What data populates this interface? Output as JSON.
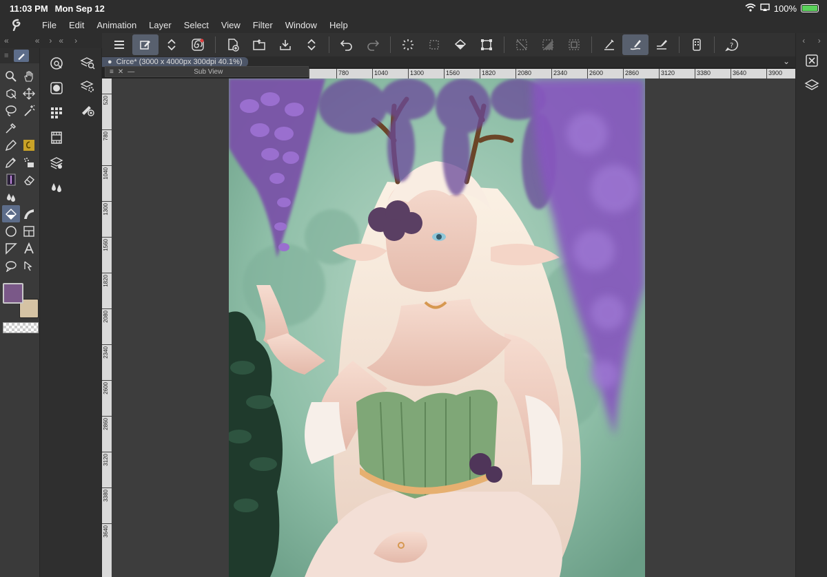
{
  "status": {
    "time": "11:03 PM",
    "date": "Mon Sep 12",
    "battery": "100%"
  },
  "menu": [
    "File",
    "Edit",
    "Animation",
    "Layer",
    "Select",
    "View",
    "Filter",
    "Window",
    "Help"
  ],
  "document": {
    "tab": "Circe* (3000 x 4000px 300dpi 40.1%)",
    "subview_title": "Sub View"
  },
  "ruler": {
    "h": [
      "780",
      "1040",
      "1300",
      "1560",
      "1820",
      "2080",
      "2340",
      "2600",
      "2860",
      "3120",
      "3380",
      "3640",
      "3900"
    ],
    "v": [
      "520",
      "780",
      "1040",
      "1300",
      "1560",
      "1820",
      "2080",
      "2340",
      "2600",
      "2860",
      "3120",
      "3380",
      "3640"
    ]
  },
  "colors": {
    "main": "#7a5888",
    "sub": "#d5c3a4",
    "accent": "#58606e",
    "tool_selected": "#5d6d8a"
  },
  "toolbar_icons": [
    "menu-icon",
    "transform-tool-icon",
    "up-down-arrows-icon",
    "spiral-icon",
    "new-canvas-icon",
    "open-folder-icon",
    "save-icon",
    "up-down-arrows-icon",
    "undo-icon",
    "redo-icon",
    "loading-icon",
    "clear-selection-icon",
    "fill-icon",
    "crop-icon",
    "deselect-icon",
    "invert-selection-icon",
    "show-selection-icon",
    "ruler-snap-icon",
    "brush-stroke-icon",
    "snap-line-icon",
    "device-icon",
    "help-icon"
  ]
}
